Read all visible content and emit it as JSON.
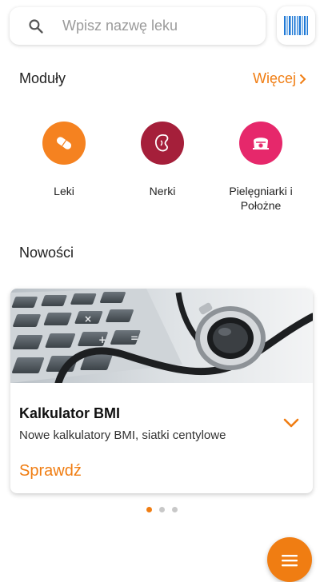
{
  "search": {
    "placeholder": "Wpisz nazwę leku",
    "value": "",
    "icon": "search-icon",
    "barcode_icon": "barcode-icon"
  },
  "modules": {
    "title": "Moduły",
    "more_label": "Więcej",
    "items": [
      {
        "label": "Leki",
        "icon": "pill-icon",
        "color": "#f58220"
      },
      {
        "label": "Nerki",
        "icon": "kidney-icon",
        "color": "#a51f3a"
      },
      {
        "label": "Pielęgniarki i Położne",
        "icon": "nurse-cap-icon",
        "color": "#e6286b"
      }
    ]
  },
  "news": {
    "title": "Nowości",
    "card": {
      "title": "Kalkulator BMI",
      "subtitle": "Nowe kalkulatory BMI, siatki centylowe",
      "action_label": "Sprawdź",
      "image": "calculator-stethoscope-photo"
    },
    "pager": {
      "count": 3,
      "active": 0
    }
  },
  "fab": {
    "icon": "menu-icon"
  },
  "colors": {
    "accent": "#f07d12",
    "barcode": "#1e78d6"
  }
}
